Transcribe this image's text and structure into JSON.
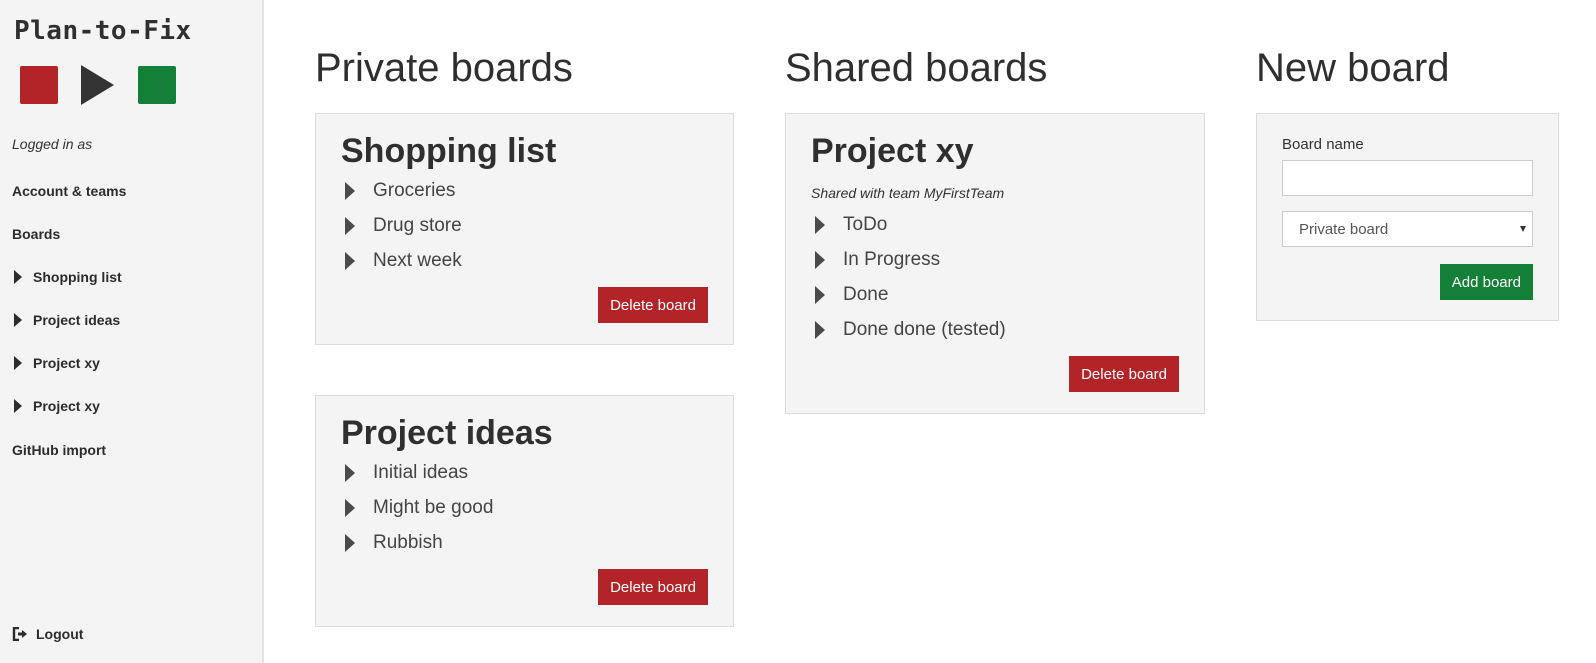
{
  "app": {
    "title": "Plan-to-Fix",
    "logo_icons": [
      "red-square-icon",
      "play-icon",
      "green-square-icon"
    ],
    "colors": {
      "danger": "#b22428",
      "success": "#137f37",
      "sidebar_bg": "#f4f4f4",
      "card_bg": "#f4f4f4",
      "text": "#333333"
    }
  },
  "sidebar": {
    "logged_in_label": "Logged in as",
    "account_label": "Account & teams",
    "boards_label": "Boards",
    "board_links": [
      {
        "label": "Shopping list"
      },
      {
        "label": "Project ideas"
      },
      {
        "label": "Project xy"
      },
      {
        "label": "Project xy"
      }
    ],
    "github_import_label": "GitHub import",
    "logout_label": "Logout"
  },
  "private_boards": {
    "heading": "Private boards",
    "boards": [
      {
        "title": "Shopping list",
        "lists": [
          "Groceries",
          "Drug store",
          "Next week"
        ],
        "delete_label": "Delete board"
      },
      {
        "title": "Project ideas",
        "lists": [
          "Initial ideas",
          "Might be good",
          "Rubbish"
        ],
        "delete_label": "Delete board"
      }
    ]
  },
  "shared_boards": {
    "heading": "Shared boards",
    "boards": [
      {
        "title": "Project xy",
        "shared_with": "Shared with team MyFirstTeam",
        "lists": [
          "ToDo",
          "In Progress",
          "Done",
          "Done done (tested)"
        ],
        "delete_label": "Delete board"
      }
    ]
  },
  "new_board": {
    "heading": "New board",
    "name_label": "Board name",
    "name_value": "",
    "type_selected": "Private board",
    "add_label": "Add board"
  }
}
